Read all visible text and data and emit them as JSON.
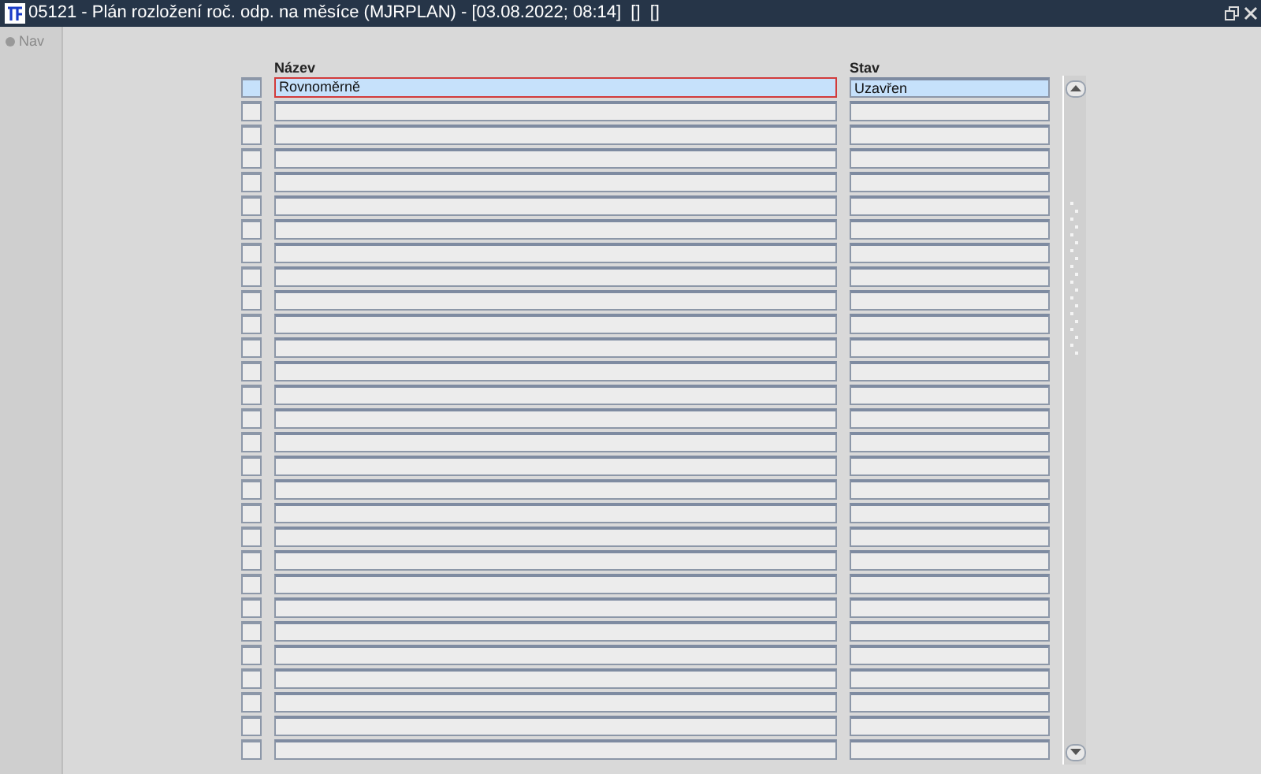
{
  "window": {
    "title": "05121 - Plán rozložení roč. odp. na měsíce (MJRPLAN) - [03.08.2022; 08:14]  []  []"
  },
  "sidebar": {
    "items": [
      {
        "label": "Nav",
        "enabled": false
      }
    ]
  },
  "table": {
    "columns": [
      "Název",
      "Stav"
    ],
    "rows": [
      {
        "name": "Rovnoměrně",
        "status": "Uzavřen",
        "selected": true,
        "focused": true
      },
      {
        "selected": false,
        "focused": false
      },
      {
        "selected": false,
        "focused": false
      },
      {
        "selected": false,
        "focused": false
      },
      {
        "selected": false,
        "focused": false
      },
      {
        "selected": false,
        "focused": false
      },
      {
        "selected": false,
        "focused": false
      },
      {
        "selected": false,
        "focused": false
      },
      {
        "selected": false,
        "focused": false
      },
      {
        "selected": false,
        "focused": false
      },
      {
        "selected": false,
        "focused": false
      },
      {
        "selected": false,
        "focused": false
      },
      {
        "selected": false,
        "focused": false
      },
      {
        "selected": false,
        "focused": false
      },
      {
        "selected": false,
        "focused": false
      },
      {
        "selected": false,
        "focused": false
      },
      {
        "selected": false,
        "focused": false
      },
      {
        "selected": false,
        "focused": false
      },
      {
        "selected": false,
        "focused": false
      },
      {
        "selected": false,
        "focused": false
      },
      {
        "selected": false,
        "focused": false
      },
      {
        "selected": false,
        "focused": false
      },
      {
        "selected": false,
        "focused": false
      },
      {
        "selected": false,
        "focused": false
      },
      {
        "selected": false,
        "focused": false
      },
      {
        "selected": false,
        "focused": false
      },
      {
        "selected": false,
        "focused": false
      },
      {
        "selected": false,
        "focused": false
      },
      {
        "selected": false,
        "focused": false
      }
    ]
  }
}
